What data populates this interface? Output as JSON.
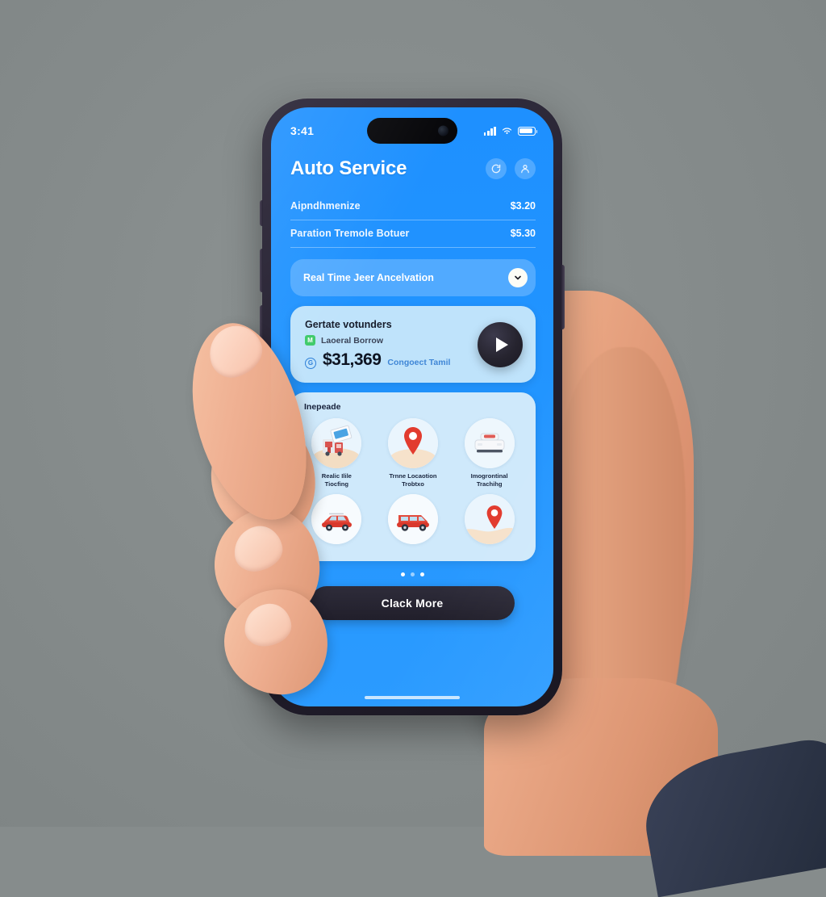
{
  "status_bar": {
    "time": "3:41",
    "signal_icon": "cellular-signal-icon",
    "wifi_icon": "wifi-icon",
    "battery_icon": "battery-icon"
  },
  "header": {
    "title": "Auto Service",
    "actions": [
      {
        "name": "refresh-icon",
        "label": "Refresh"
      },
      {
        "name": "profile-icon",
        "label": "Profile"
      }
    ]
  },
  "rows": [
    {
      "label": "Aipndhmenize",
      "value": "$3.20"
    },
    {
      "label": "Paration Tremole Botuer",
      "value": "$5.30"
    }
  ],
  "dropdown": {
    "label": "Real Time Jeer Ancelvation",
    "chevron_icon": "chevron-down-icon"
  },
  "balance_card": {
    "title": "Gertate votunders",
    "sub_label": "Laoeral Borrow",
    "sub_badge": "M",
    "amount_badge": "G",
    "amount": "$31,369",
    "amount_note": "Congoect Tamil",
    "play_icon": "play-icon"
  },
  "grid_card": {
    "title": "Inepeade",
    "items": [
      {
        "label": "Realic Ilile Tiocfing",
        "icon": "truck-delivery-icon"
      },
      {
        "label": "Trnne Locaotion Trobtxo",
        "icon": "map-pin-icon"
      },
      {
        "label": "Imogrontinal Trachihg",
        "icon": "car-rear-icon"
      },
      {
        "label": "",
        "icon": "red-hatchback-icon"
      },
      {
        "label": "",
        "icon": "red-wagon-icon"
      },
      {
        "label": "",
        "icon": "map-pin-hand-icon"
      }
    ]
  },
  "pagination": {
    "count": 3,
    "active_index": 0
  },
  "cta": {
    "label": "Clack More"
  },
  "colors": {
    "screen_blue": "#1e90ff",
    "card_light_blue": "#bfe3fb",
    "grid_card_blue": "#cfe9fb",
    "cta_dark": "#262230",
    "accent_red": "#e23b2e",
    "accent_green": "#3fca6a",
    "background_gray": "#868c8c"
  }
}
